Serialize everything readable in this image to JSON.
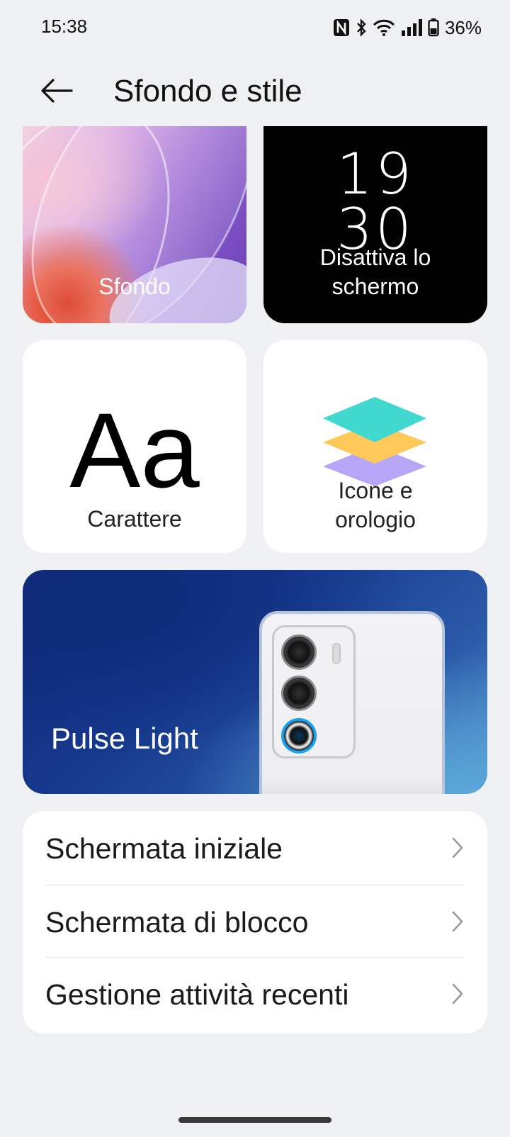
{
  "status_bar": {
    "time": "15:38",
    "battery_percent": "36%",
    "icons": [
      "nfc-icon",
      "bluetooth-icon",
      "wifi-icon",
      "signal-icon",
      "battery-icon"
    ]
  },
  "header": {
    "back_icon": "arrow-left-icon",
    "title": "Sfondo e stile"
  },
  "tiles": {
    "wallpaper": {
      "label": "Sfondo"
    },
    "screen_off": {
      "clock_hour": "19",
      "clock_minute": "30",
      "label_line1": "Disattiva lo",
      "label_line2": "schermo"
    },
    "font": {
      "sample": "Aa",
      "label": "Carattere"
    },
    "icons": {
      "label_line1": "Icone e",
      "label_line2": "orologio",
      "layer_colors": [
        "#41d8d0",
        "#ffc95a",
        "#b6a6f5"
      ]
    }
  },
  "banner": {
    "label": "Pulse Light"
  },
  "settings_list": {
    "items": [
      {
        "label": "Schermata iniziale"
      },
      {
        "label": "Schermata di blocco"
      },
      {
        "label": "Gestione attività recenti"
      }
    ]
  },
  "colors": {
    "background": "#eff0f2",
    "card": "#ffffff",
    "accent_lens_ring": "#1aa0f0"
  }
}
